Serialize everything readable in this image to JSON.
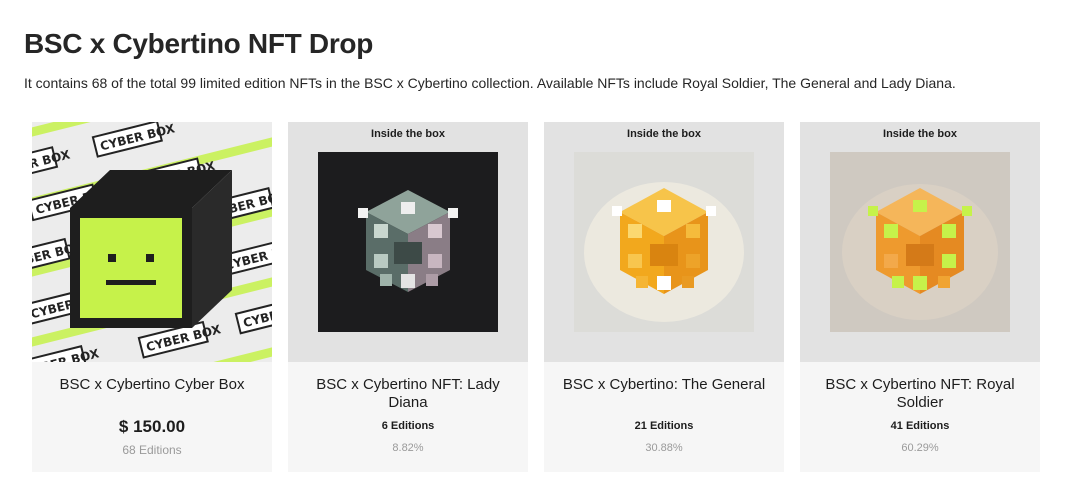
{
  "page": {
    "title": "BSC x Cybertino NFT Drop",
    "description": "It contains 68 of the total 99 limited edition NFTs in the BSC x Cybertino collection. Available NFTs include Royal Soldier, The General and Lady Diana."
  },
  "colors": {
    "card_bg": "#f6f6f6",
    "media_bg": "#e2e2e2",
    "cyber_green": "#c6f24a",
    "box_dark": "#232323",
    "gold": "#f2a81d",
    "amber": "#f0a432"
  },
  "cards": [
    {
      "name": "BSC x Cybertino Cyber Box",
      "price": "$ 150.00",
      "editions": "68 Editions",
      "art": "cyber-box-art",
      "tile_text": "CYBER BOX"
    },
    {
      "inside_label": "Inside the box",
      "name": "BSC x Cybertino NFT: Lady Diana",
      "editions": "6 Editions",
      "percent": "8.82%",
      "art": "lady-diana-cube-art"
    },
    {
      "inside_label": "Inside the box",
      "name": "BSC x Cybertino: The General",
      "editions": "21 Editions",
      "percent": "30.88%",
      "art": "the-general-cube-art"
    },
    {
      "inside_label": "Inside the box",
      "name": "BSC x Cybertino NFT: Royal Soldier",
      "editions": "41 Editions",
      "percent": "60.29%",
      "art": "royal-soldier-cube-art"
    }
  ]
}
